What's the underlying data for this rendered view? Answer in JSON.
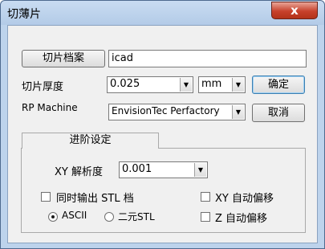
{
  "window": {
    "title": "切薄片",
    "close_glyph": "x"
  },
  "slice_file": {
    "button_label": "切片档案",
    "value": "icad"
  },
  "thickness": {
    "label": "切片厚度",
    "value": "0.025",
    "unit": "mm"
  },
  "rp_machine": {
    "label": "RP Machine",
    "value": "EnvisionTec Perfactory"
  },
  "actions": {
    "ok_label": "确定",
    "cancel_label": "取消"
  },
  "advanced": {
    "tab_label": "进阶设定",
    "xy_resolution": {
      "label": "XY 解析度",
      "value": "0.001"
    },
    "also_export_stl": {
      "label": "同时输出 STL 档",
      "checked": false
    },
    "format": {
      "options": [
        "ASCII",
        "二元STL"
      ],
      "selected": "ASCII"
    },
    "xy_auto_offset": {
      "label": "XY 自动偏移",
      "checked": false
    },
    "z_auto_offset": {
      "label": "Z 自动偏移",
      "checked": false
    }
  },
  "icons": {
    "dropdown": "chevron-down-icon",
    "close": "close-icon"
  }
}
